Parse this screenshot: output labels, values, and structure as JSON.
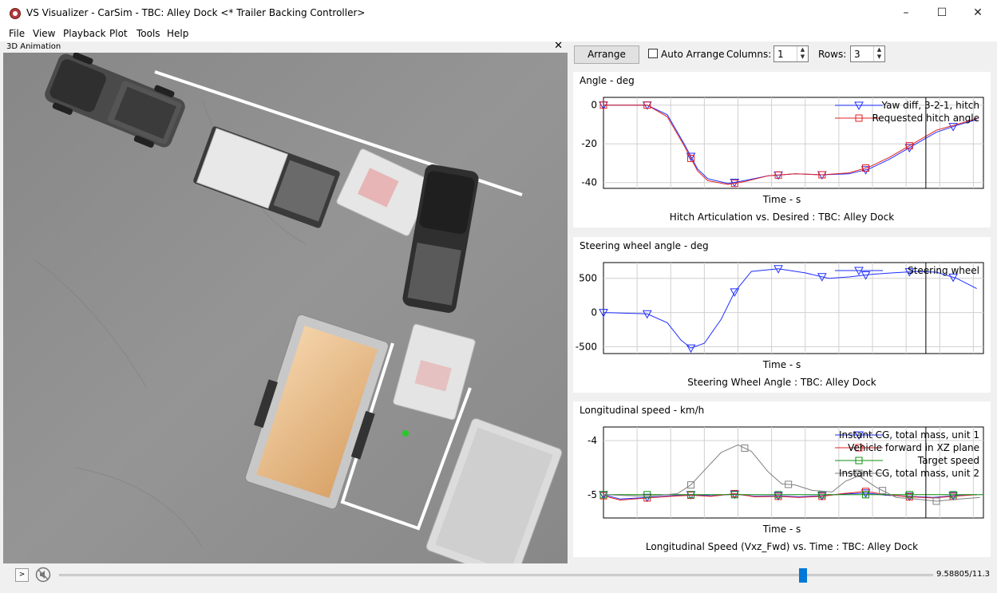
{
  "window": {
    "title": "VS Visualizer - CarSim - TBC: Alley Dock <* Trailer Backing Controller>",
    "minimize": "–",
    "maximize": "☐",
    "close": "✕"
  },
  "menu": [
    "File",
    "View",
    "Playback",
    "Plot",
    "Tools",
    "Help"
  ],
  "animation": {
    "title": "3D Animation",
    "close": "✕"
  },
  "toolbar": {
    "arrange": "Arrange",
    "auto_arrange": "Auto Arrange",
    "columns_label": "Columns:",
    "columns_value": "1",
    "rows_label": "Rows:",
    "rows_value": "3"
  },
  "colors": {
    "blue": "#1f2fff",
    "red": "#e02020",
    "green": "#109010",
    "gray": "#808080",
    "accent": "#0078d7"
  },
  "playback": {
    "play": ">",
    "progress": 0.851,
    "time": "9.58805/11.3"
  },
  "chart_data": [
    {
      "type": "line",
      "ylabel": "Angle - deg",
      "xlabel": "Time - s",
      "title": "Hitch Articulation vs. Desired : TBC: Alley Dock",
      "x_range": [
        0,
        11.3
      ],
      "ylim": [
        -43,
        4
      ],
      "yticks": [
        0,
        -20,
        -40
      ],
      "cursor_x": 9.588,
      "legend": "top-right",
      "series": [
        {
          "name": "Yaw diff, 3-2-1, hitch",
          "color": "blue",
          "marker": "triangle",
          "points": [
            [
              0,
              0
            ],
            [
              1.3,
              0
            ],
            [
              1.9,
              -5
            ],
            [
              2.4,
              -20
            ],
            [
              2.8,
              -33
            ],
            [
              3.1,
              -38
            ],
            [
              3.7,
              -40.5
            ],
            [
              4.2,
              -39
            ],
            [
              4.9,
              -36.5
            ],
            [
              5.7,
              -35.5
            ],
            [
              6.5,
              -36
            ],
            [
              7.3,
              -35.5
            ],
            [
              7.9,
              -33
            ],
            [
              8.5,
              -28
            ],
            [
              9.2,
              -21
            ],
            [
              9.9,
              -14
            ],
            [
              10.5,
              -10.5
            ],
            [
              11.1,
              -7.5
            ]
          ],
          "markers_x": [
            0,
            1.3,
            2.6,
            3.9,
            5.2,
            6.5,
            7.8,
            9.1,
            10.4
          ]
        },
        {
          "name": "Requested hitch angle",
          "color": "red",
          "marker": "square",
          "points": [
            [
              0,
              0
            ],
            [
              1.3,
              0
            ],
            [
              1.9,
              -6
            ],
            [
              2.4,
              -21
            ],
            [
              2.8,
              -34
            ],
            [
              3.1,
              -39
            ],
            [
              3.7,
              -41
            ],
            [
              4.2,
              -39.5
            ],
            [
              4.9,
              -36.5
            ],
            [
              5.7,
              -35.5
            ],
            [
              6.5,
              -36
            ],
            [
              7.3,
              -35
            ],
            [
              7.9,
              -32
            ],
            [
              8.5,
              -27
            ],
            [
              9.2,
              -20
            ],
            [
              9.9,
              -13
            ],
            [
              10.5,
              -10
            ],
            [
              11.1,
              -7
            ]
          ],
          "markers_x": [
            0,
            1.3,
            2.6,
            3.9,
            5.2,
            6.5,
            7.8,
            9.1
          ]
        }
      ]
    },
    {
      "type": "line",
      "ylabel": "Steering wheel angle - deg",
      "xlabel": "Time - s",
      "title": "Steering Wheel Angle : TBC: Alley Dock",
      "x_range": [
        0,
        11.3
      ],
      "ylim": [
        -600,
        730
      ],
      "yticks": [
        500,
        0,
        -500
      ],
      "cursor_x": 9.588,
      "legend": "top-right",
      "series": [
        {
          "name": "Steering wheel",
          "color": "blue",
          "marker": "triangle",
          "points": [
            [
              0,
              0
            ],
            [
              1.3,
              -20
            ],
            [
              1.9,
              -150
            ],
            [
              2.3,
              -400
            ],
            [
              2.6,
              -520
            ],
            [
              3.0,
              -450
            ],
            [
              3.5,
              -100
            ],
            [
              3.9,
              300
            ],
            [
              4.4,
              600
            ],
            [
              5.2,
              640
            ],
            [
              6.0,
              580
            ],
            [
              6.7,
              500
            ],
            [
              7.3,
              520
            ],
            [
              8.0,
              560
            ],
            [
              8.6,
              580
            ],
            [
              9.3,
              600
            ],
            [
              9.9,
              590
            ],
            [
              10.5,
              500
            ],
            [
              11.1,
              350
            ]
          ],
          "markers_x": [
            0,
            1.3,
            2.6,
            3.9,
            5.2,
            6.5,
            7.8,
            9.1,
            10.4
          ]
        }
      ]
    },
    {
      "type": "line",
      "ylabel": "Longitudinal speed - km/h",
      "xlabel": "Time - s",
      "title": "Longitudinal Speed (Vxz_Fwd) vs. Time : TBC: Alley Dock",
      "x_range": [
        0,
        11.3
      ],
      "ylim": [
        -5.43,
        -3.75
      ],
      "yticks": [
        -4,
        -5
      ],
      "cursor_x": 9.588,
      "legend": "top-right",
      "series": [
        {
          "name": "Instant CG, total mass, unit 1",
          "color": "blue",
          "marker": "triangle",
          "points": [
            [
              0,
              -5.0
            ],
            [
              0.5,
              -5.08
            ],
            [
              1.3,
              -5.05
            ],
            [
              2.0,
              -5.02
            ],
            [
              2.6,
              -5.0
            ],
            [
              3.2,
              -5.02
            ],
            [
              3.9,
              -4.99
            ],
            [
              4.5,
              -5.03
            ],
            [
              5.2,
              -5.02
            ],
            [
              5.8,
              -5.04
            ],
            [
              6.5,
              -5.02
            ],
            [
              7.1,
              -4.99
            ],
            [
              7.8,
              -4.97
            ],
            [
              8.4,
              -5.01
            ],
            [
              9.1,
              -5.03
            ],
            [
              9.8,
              -5.05
            ],
            [
              10.4,
              -5.02
            ],
            [
              11.1,
              -5.0
            ]
          ],
          "markers_x": [
            0,
            1.3,
            2.6,
            3.9,
            5.2,
            6.5,
            7.8,
            9.1,
            10.4
          ]
        },
        {
          "name": "Vehicle forward in XZ plane",
          "color": "red",
          "marker": "square",
          "points": [
            [
              0,
              -5.02
            ],
            [
              0.5,
              -5.1
            ],
            [
              1.3,
              -5.06
            ],
            [
              2.0,
              -5.03
            ],
            [
              2.6,
              -5.01
            ],
            [
              3.2,
              -5.03
            ],
            [
              3.9,
              -4.98
            ],
            [
              4.5,
              -5.04
            ],
            [
              5.2,
              -5.03
            ],
            [
              5.8,
              -5.05
            ],
            [
              6.5,
              -5.03
            ],
            [
              7.1,
              -4.98
            ],
            [
              7.8,
              -4.94
            ],
            [
              8.4,
              -5.0
            ],
            [
              9.1,
              -5.04
            ],
            [
              9.8,
              -5.06
            ],
            [
              10.4,
              -5.03
            ],
            [
              11.1,
              -5.0
            ]
          ],
          "markers_x": [
            0,
            1.3,
            2.6,
            3.9,
            5.2,
            6.5,
            7.8,
            9.1,
            10.4
          ]
        },
        {
          "name": "Target speed",
          "color": "green",
          "marker": "square",
          "points": [
            [
              0,
              -5.0
            ],
            [
              11.3,
              -5.0
            ]
          ],
          "markers_x": [
            0,
            1.3,
            2.6,
            3.9,
            5.2,
            6.5,
            7.8,
            9.1,
            10.4
          ]
        },
        {
          "name": "Instant CG, total mass, unit 2",
          "color": "gray",
          "marker": "square",
          "points": [
            [
              0,
              -5.0
            ],
            [
              1.3,
              -5.03
            ],
            [
              2.2,
              -4.98
            ],
            [
              2.6,
              -4.82
            ],
            [
              3.0,
              -4.55
            ],
            [
              3.5,
              -4.22
            ],
            [
              4.0,
              -4.08
            ],
            [
              4.4,
              -4.2
            ],
            [
              4.9,
              -4.58
            ],
            [
              5.3,
              -4.8
            ],
            [
              5.7,
              -4.82
            ],
            [
              6.2,
              -4.92
            ],
            [
              6.8,
              -4.95
            ],
            [
              7.2,
              -4.75
            ],
            [
              7.6,
              -4.65
            ],
            [
              8.1,
              -4.86
            ],
            [
              8.7,
              -5.05
            ],
            [
              9.3,
              -5.08
            ],
            [
              9.9,
              -5.12
            ],
            [
              10.6,
              -5.08
            ],
            [
              11.2,
              -5.05
            ]
          ],
          "markers_x": [
            2.6,
            4.2,
            5.5,
            8.3,
            9.9
          ]
        }
      ]
    }
  ]
}
